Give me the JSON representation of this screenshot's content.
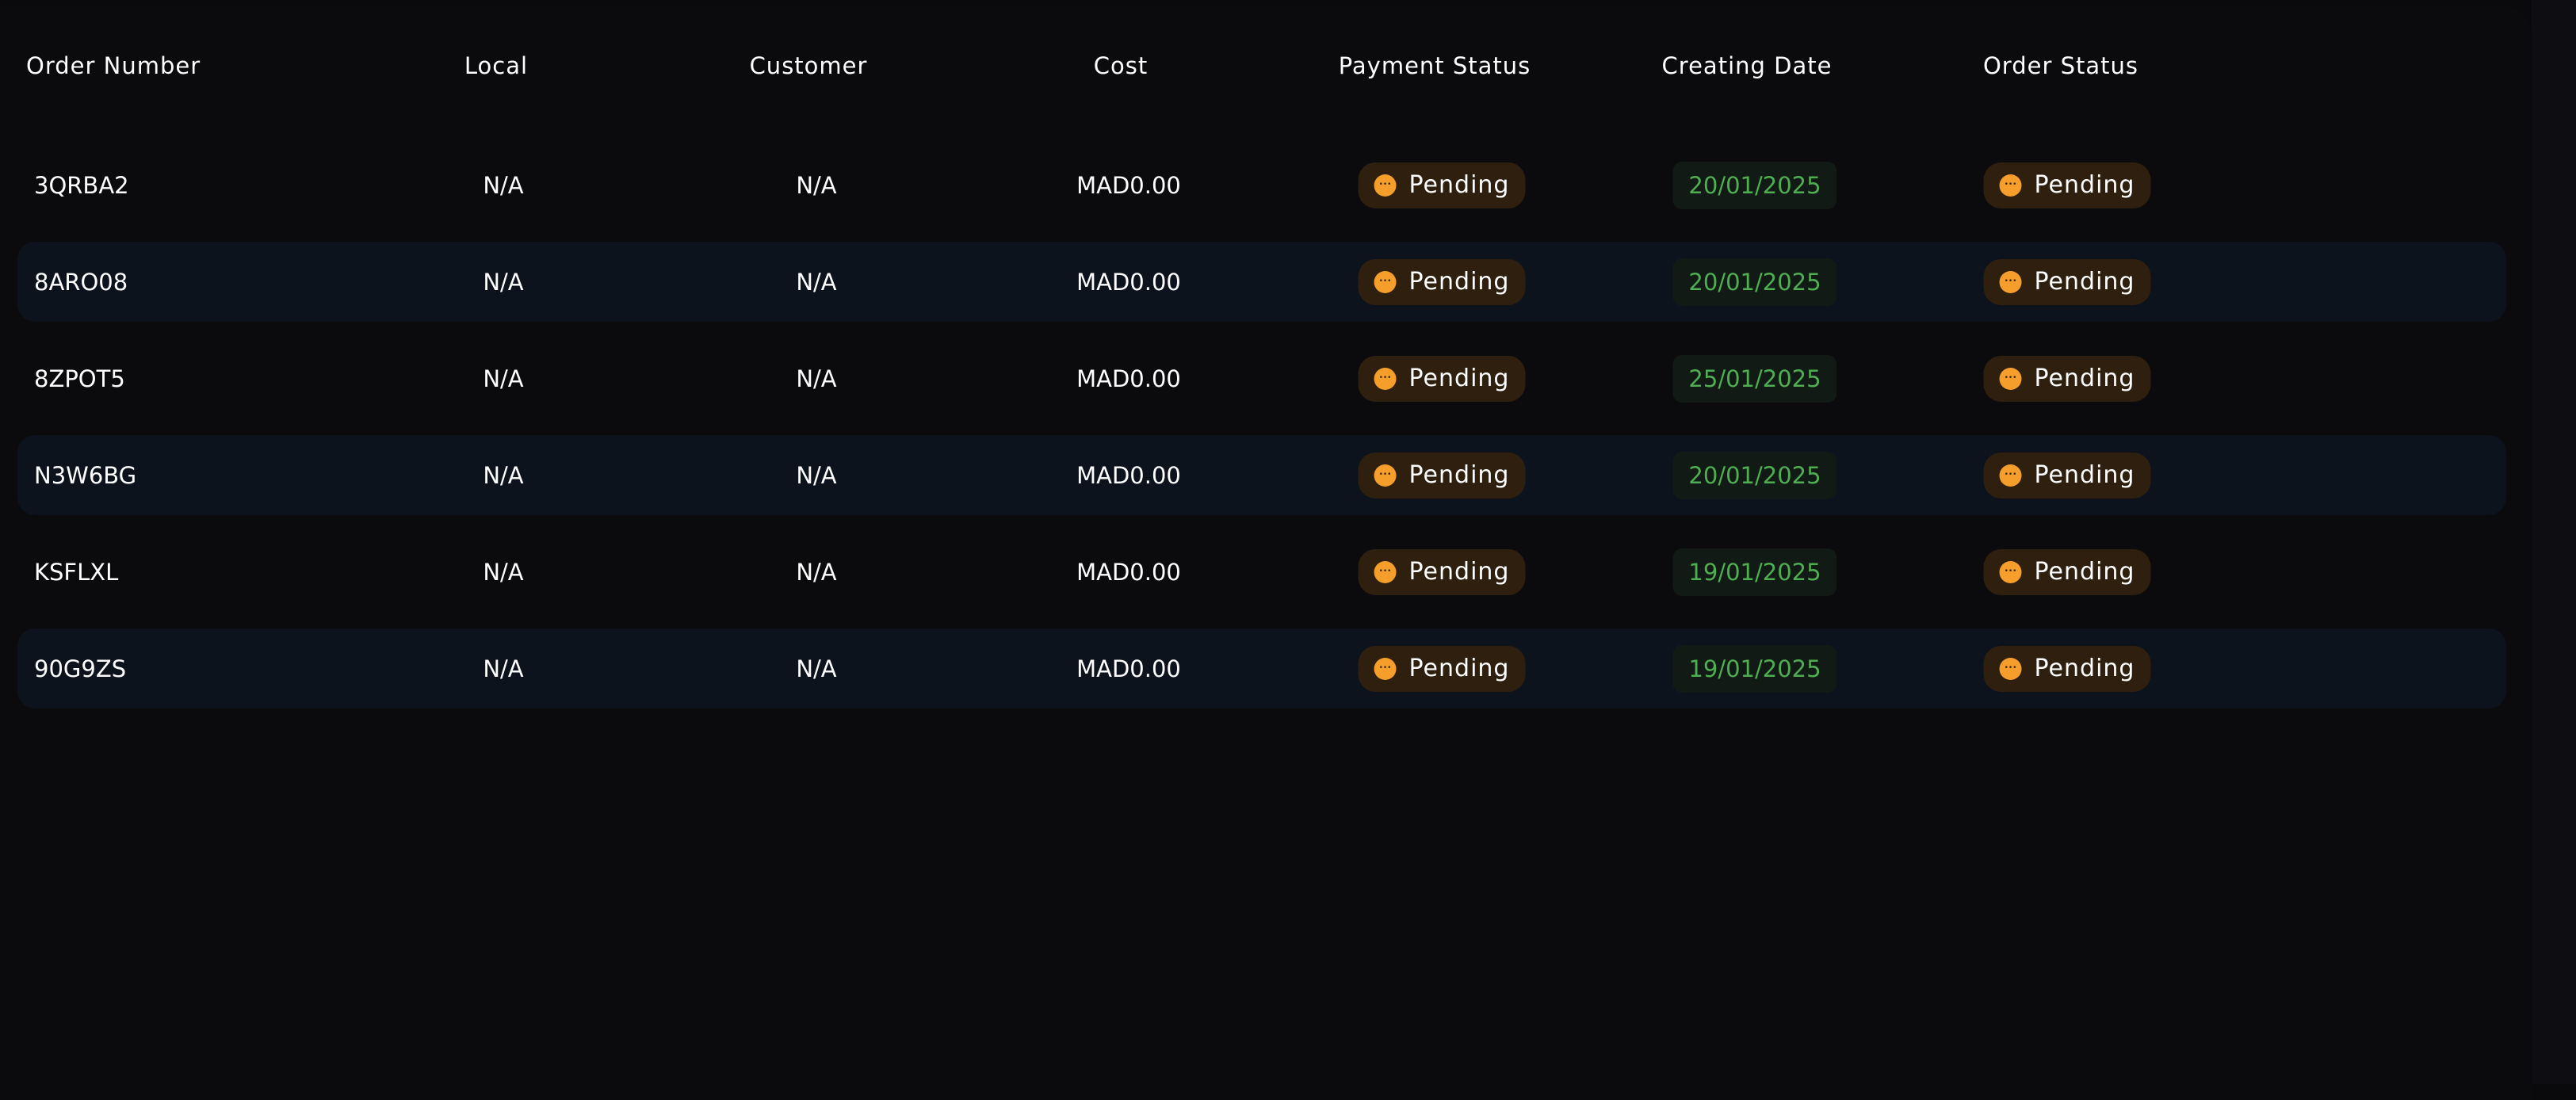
{
  "table": {
    "headers": {
      "order_number": "Order Number",
      "local": "Local",
      "customer": "Customer",
      "cost": "Cost",
      "payment_status": "Payment Status",
      "creating_date": "Creating Date",
      "order_status": "Order Status"
    },
    "rows": [
      {
        "order_number": "3QRBA2",
        "local": "N/A",
        "customer": "N/A",
        "cost": "MAD0.00",
        "payment_status": "Pending",
        "creating_date": "20/01/2025",
        "order_status": "Pending"
      },
      {
        "order_number": "8ARO08",
        "local": "N/A",
        "customer": "N/A",
        "cost": "MAD0.00",
        "payment_status": "Pending",
        "creating_date": "20/01/2025",
        "order_status": "Pending"
      },
      {
        "order_number": "8ZPOT5",
        "local": "N/A",
        "customer": "N/A",
        "cost": "MAD0.00",
        "payment_status": "Pending",
        "creating_date": "25/01/2025",
        "order_status": "Pending"
      },
      {
        "order_number": "N3W6BG",
        "local": "N/A",
        "customer": "N/A",
        "cost": "MAD0.00",
        "payment_status": "Pending",
        "creating_date": "20/01/2025",
        "order_status": "Pending"
      },
      {
        "order_number": "KSFLXL",
        "local": "N/A",
        "customer": "N/A",
        "cost": "MAD0.00",
        "payment_status": "Pending",
        "creating_date": "19/01/2025",
        "order_status": "Pending"
      },
      {
        "order_number": "90G9ZS",
        "local": "N/A",
        "customer": "N/A",
        "cost": "MAD0.00",
        "payment_status": "Pending",
        "creating_date": "19/01/2025",
        "order_status": "Pending"
      }
    ]
  },
  "colors": {
    "background": "#0b0b0e",
    "row_alt": "#0c131d",
    "pending_badge_bg": "#2e1f0e",
    "pending_icon": "#f59e2b",
    "date_text": "#4fae52",
    "date_badge_bg": "#111a14"
  },
  "icons": {
    "pending": "pending-dots-icon"
  }
}
